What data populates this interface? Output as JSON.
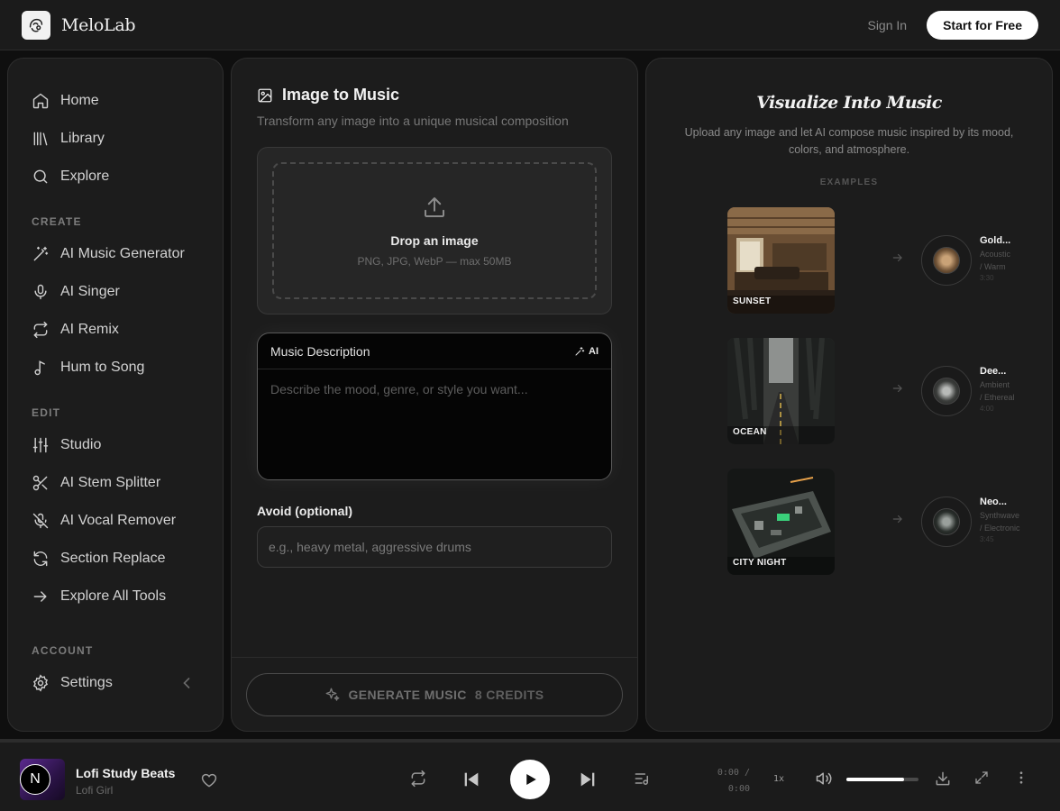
{
  "header": {
    "brand": "MeloLab",
    "sign_in": "Sign In",
    "start_label": "Start for Free"
  },
  "sidebar": {
    "main": [
      {
        "label": "Home",
        "icon": "home-icon"
      },
      {
        "label": "Library",
        "icon": "library-icon"
      },
      {
        "label": "Explore",
        "icon": "search-icon"
      }
    ],
    "create_label": "CREATE",
    "create": [
      {
        "label": "AI Music Generator",
        "icon": "magic-wand-icon"
      },
      {
        "label": "AI Singer",
        "icon": "microphone-icon"
      },
      {
        "label": "AI Remix",
        "icon": "repeat-icon"
      },
      {
        "label": "Hum to Song",
        "icon": "music-note-icon"
      }
    ],
    "edit_label": "EDIT",
    "edit": [
      {
        "label": "Studio",
        "icon": "sliders-icon"
      },
      {
        "label": "AI Stem Splitter",
        "icon": "scissors-icon"
      },
      {
        "label": "AI Vocal Remover",
        "icon": "mic-off-icon"
      },
      {
        "label": "Section Replace",
        "icon": "refresh-icon"
      },
      {
        "label": "Explore All Tools",
        "icon": "arrow-right-icon"
      }
    ],
    "account_label": "ACCOUNT",
    "settings": {
      "label": "Settings",
      "icon": "gear-icon"
    }
  },
  "center": {
    "title": "Image to Music",
    "subtitle": "Transform any image into a unique musical composition",
    "drop_title": "Drop an image",
    "drop_hint": "PNG, JPG, WebP — max 50MB",
    "desc_label": "Music Description",
    "ai_label": "AI",
    "desc_placeholder": "Describe the mood, genre, or style you want...",
    "avoid_label": "Avoid (optional)",
    "avoid_placeholder": "e.g., heavy metal, aggressive drums",
    "generate_label": "GENERATE MUSIC",
    "credits": "8 CREDITS"
  },
  "right": {
    "title": "Visualize Into Music",
    "subtitle": "Upload any image and let AI compose music inspired by its mood, colors, and atmosphere.",
    "examples_label": "EXAMPLES",
    "examples": [
      {
        "image_label": "SUNSET",
        "name": "Gold...",
        "genre1": "Acoustic",
        "genre2": "/ Warm",
        "duration": "3:30",
        "tone": "#8a6a48"
      },
      {
        "image_label": "OCEAN",
        "name": "Dee...",
        "genre1": "Ambient",
        "genre2": "/ Ethereal",
        "duration": "4:00",
        "tone": "#3c3e3c"
      },
      {
        "image_label": "CITY NIGHT",
        "name": "Neo...",
        "genre1": "Synthwave",
        "genre2": "/ Electronic",
        "duration": "3:45",
        "tone": "#2a2f2c"
      }
    ]
  },
  "player": {
    "avatar_letter": "N",
    "title": "Lofi Study Beats",
    "artist": "Lofi Girl",
    "time_current": "0:00 /",
    "time_total": "0:00",
    "speed": "1x",
    "volume": 0.8
  }
}
